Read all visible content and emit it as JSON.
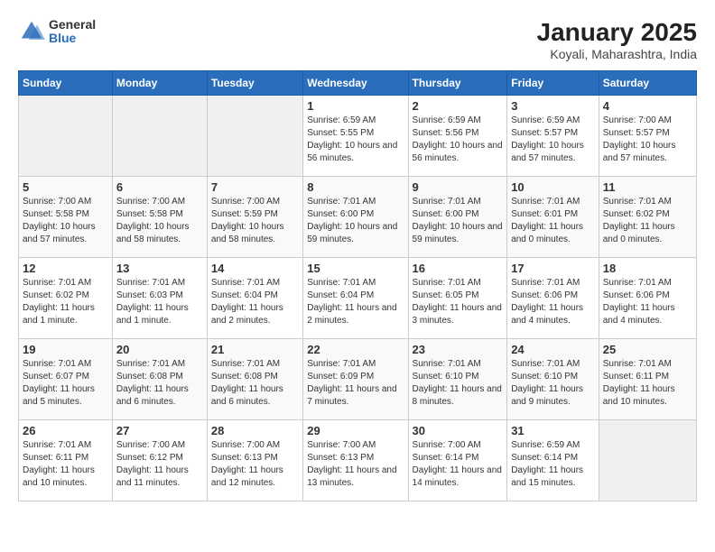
{
  "header": {
    "logo_general": "General",
    "logo_blue": "Blue",
    "title": "January 2025",
    "subtitle": "Koyali, Maharashtra, India"
  },
  "days_of_week": [
    "Sunday",
    "Monday",
    "Tuesday",
    "Wednesday",
    "Thursday",
    "Friday",
    "Saturday"
  ],
  "weeks": [
    [
      {
        "day": "",
        "info": ""
      },
      {
        "day": "",
        "info": ""
      },
      {
        "day": "",
        "info": ""
      },
      {
        "day": "1",
        "info": "Sunrise: 6:59 AM\nSunset: 5:55 PM\nDaylight: 10 hours and 56 minutes."
      },
      {
        "day": "2",
        "info": "Sunrise: 6:59 AM\nSunset: 5:56 PM\nDaylight: 10 hours and 56 minutes."
      },
      {
        "day": "3",
        "info": "Sunrise: 6:59 AM\nSunset: 5:57 PM\nDaylight: 10 hours and 57 minutes."
      },
      {
        "day": "4",
        "info": "Sunrise: 7:00 AM\nSunset: 5:57 PM\nDaylight: 10 hours and 57 minutes."
      }
    ],
    [
      {
        "day": "5",
        "info": "Sunrise: 7:00 AM\nSunset: 5:58 PM\nDaylight: 10 hours and 57 minutes."
      },
      {
        "day": "6",
        "info": "Sunrise: 7:00 AM\nSunset: 5:58 PM\nDaylight: 10 hours and 58 minutes."
      },
      {
        "day": "7",
        "info": "Sunrise: 7:00 AM\nSunset: 5:59 PM\nDaylight: 10 hours and 58 minutes."
      },
      {
        "day": "8",
        "info": "Sunrise: 7:01 AM\nSunset: 6:00 PM\nDaylight: 10 hours and 59 minutes."
      },
      {
        "day": "9",
        "info": "Sunrise: 7:01 AM\nSunset: 6:00 PM\nDaylight: 10 hours and 59 minutes."
      },
      {
        "day": "10",
        "info": "Sunrise: 7:01 AM\nSunset: 6:01 PM\nDaylight: 11 hours and 0 minutes."
      },
      {
        "day": "11",
        "info": "Sunrise: 7:01 AM\nSunset: 6:02 PM\nDaylight: 11 hours and 0 minutes."
      }
    ],
    [
      {
        "day": "12",
        "info": "Sunrise: 7:01 AM\nSunset: 6:02 PM\nDaylight: 11 hours and 1 minute."
      },
      {
        "day": "13",
        "info": "Sunrise: 7:01 AM\nSunset: 6:03 PM\nDaylight: 11 hours and 1 minute."
      },
      {
        "day": "14",
        "info": "Sunrise: 7:01 AM\nSunset: 6:04 PM\nDaylight: 11 hours and 2 minutes."
      },
      {
        "day": "15",
        "info": "Sunrise: 7:01 AM\nSunset: 6:04 PM\nDaylight: 11 hours and 2 minutes."
      },
      {
        "day": "16",
        "info": "Sunrise: 7:01 AM\nSunset: 6:05 PM\nDaylight: 11 hours and 3 minutes."
      },
      {
        "day": "17",
        "info": "Sunrise: 7:01 AM\nSunset: 6:06 PM\nDaylight: 11 hours and 4 minutes."
      },
      {
        "day": "18",
        "info": "Sunrise: 7:01 AM\nSunset: 6:06 PM\nDaylight: 11 hours and 4 minutes."
      }
    ],
    [
      {
        "day": "19",
        "info": "Sunrise: 7:01 AM\nSunset: 6:07 PM\nDaylight: 11 hours and 5 minutes."
      },
      {
        "day": "20",
        "info": "Sunrise: 7:01 AM\nSunset: 6:08 PM\nDaylight: 11 hours and 6 minutes."
      },
      {
        "day": "21",
        "info": "Sunrise: 7:01 AM\nSunset: 6:08 PM\nDaylight: 11 hours and 6 minutes."
      },
      {
        "day": "22",
        "info": "Sunrise: 7:01 AM\nSunset: 6:09 PM\nDaylight: 11 hours and 7 minutes."
      },
      {
        "day": "23",
        "info": "Sunrise: 7:01 AM\nSunset: 6:10 PM\nDaylight: 11 hours and 8 minutes."
      },
      {
        "day": "24",
        "info": "Sunrise: 7:01 AM\nSunset: 6:10 PM\nDaylight: 11 hours and 9 minutes."
      },
      {
        "day": "25",
        "info": "Sunrise: 7:01 AM\nSunset: 6:11 PM\nDaylight: 11 hours and 10 minutes."
      }
    ],
    [
      {
        "day": "26",
        "info": "Sunrise: 7:01 AM\nSunset: 6:11 PM\nDaylight: 11 hours and 10 minutes."
      },
      {
        "day": "27",
        "info": "Sunrise: 7:00 AM\nSunset: 6:12 PM\nDaylight: 11 hours and 11 minutes."
      },
      {
        "day": "28",
        "info": "Sunrise: 7:00 AM\nSunset: 6:13 PM\nDaylight: 11 hours and 12 minutes."
      },
      {
        "day": "29",
        "info": "Sunrise: 7:00 AM\nSunset: 6:13 PM\nDaylight: 11 hours and 13 minutes."
      },
      {
        "day": "30",
        "info": "Sunrise: 7:00 AM\nSunset: 6:14 PM\nDaylight: 11 hours and 14 minutes."
      },
      {
        "day": "31",
        "info": "Sunrise: 6:59 AM\nSunset: 6:14 PM\nDaylight: 11 hours and 15 minutes."
      },
      {
        "day": "",
        "info": ""
      }
    ]
  ]
}
